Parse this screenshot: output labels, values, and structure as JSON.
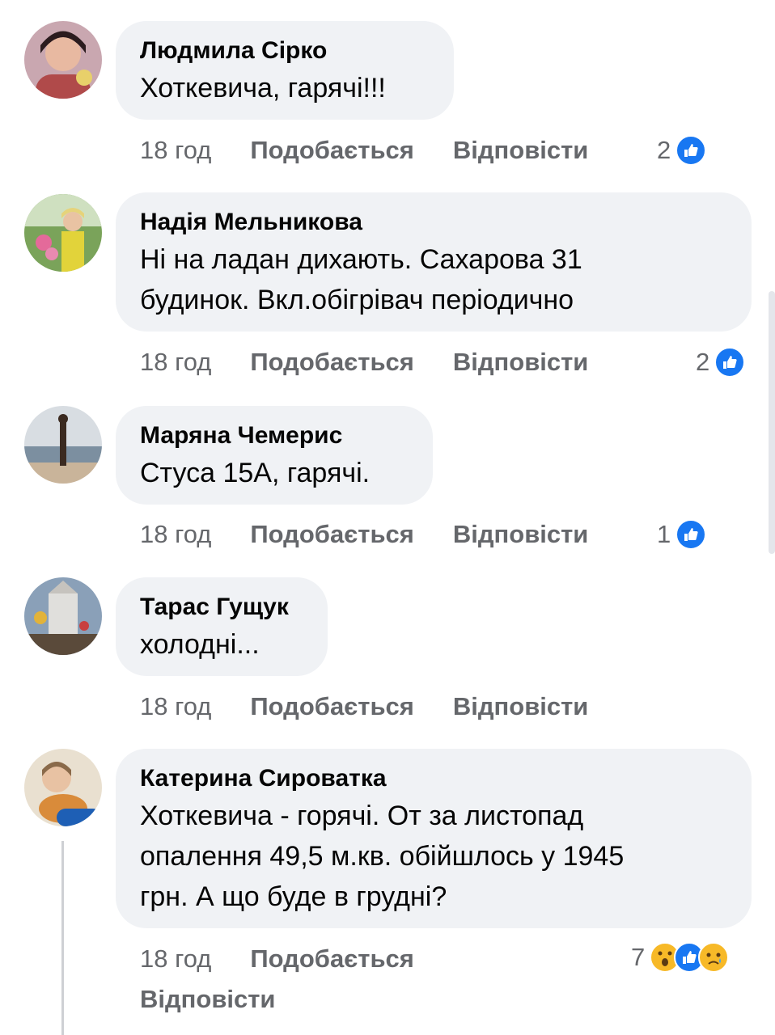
{
  "comments": [
    {
      "author": "Людмила Сірко",
      "text": "Хоткевича, гарячі!!!",
      "time": "18 год",
      "like_label": "Подобається",
      "reply_label": "Відповісти",
      "reaction_count": "2",
      "reactions": [
        "like"
      ]
    },
    {
      "author": "Надія Мельникова",
      "text_lines": [
        "Ні на ладан дихають. Сахарова 31",
        "будинок. Вкл.обігрівач періодично"
      ],
      "time": "18 год",
      "like_label": "Подобається",
      "reply_label": "Відповісти",
      "reaction_count": "2",
      "reactions": [
        "like"
      ]
    },
    {
      "author": "Маряна Чемерис",
      "text": "Стуса 15А, гарячі.",
      "time": "18 год",
      "like_label": "Подобається",
      "reply_label": "Відповісти",
      "reaction_count": "1",
      "reactions": [
        "like"
      ]
    },
    {
      "author": "Тарас Гущук",
      "text": "холодні...",
      "time": "18 год",
      "like_label": "Подобається",
      "reply_label": "Відповісти"
    },
    {
      "author": "Катерина Сироватка",
      "text_lines": [
        "Хоткевича - горячі. От за листопад",
        "опалення 49,5 м.кв. обійшлось у 1945",
        "грн. А що буде в грудні?"
      ],
      "time": "18 год",
      "like_label": "Подобається",
      "reply_label": "Відповісти",
      "reaction_count": "7",
      "reactions": [
        "wow",
        "like",
        "sad"
      ]
    }
  ],
  "colors": {
    "bubble": "#f0f2f5",
    "meta_text": "#65676b",
    "like_blue": "#1877f2",
    "emoji_yellow": "#f7b928"
  }
}
